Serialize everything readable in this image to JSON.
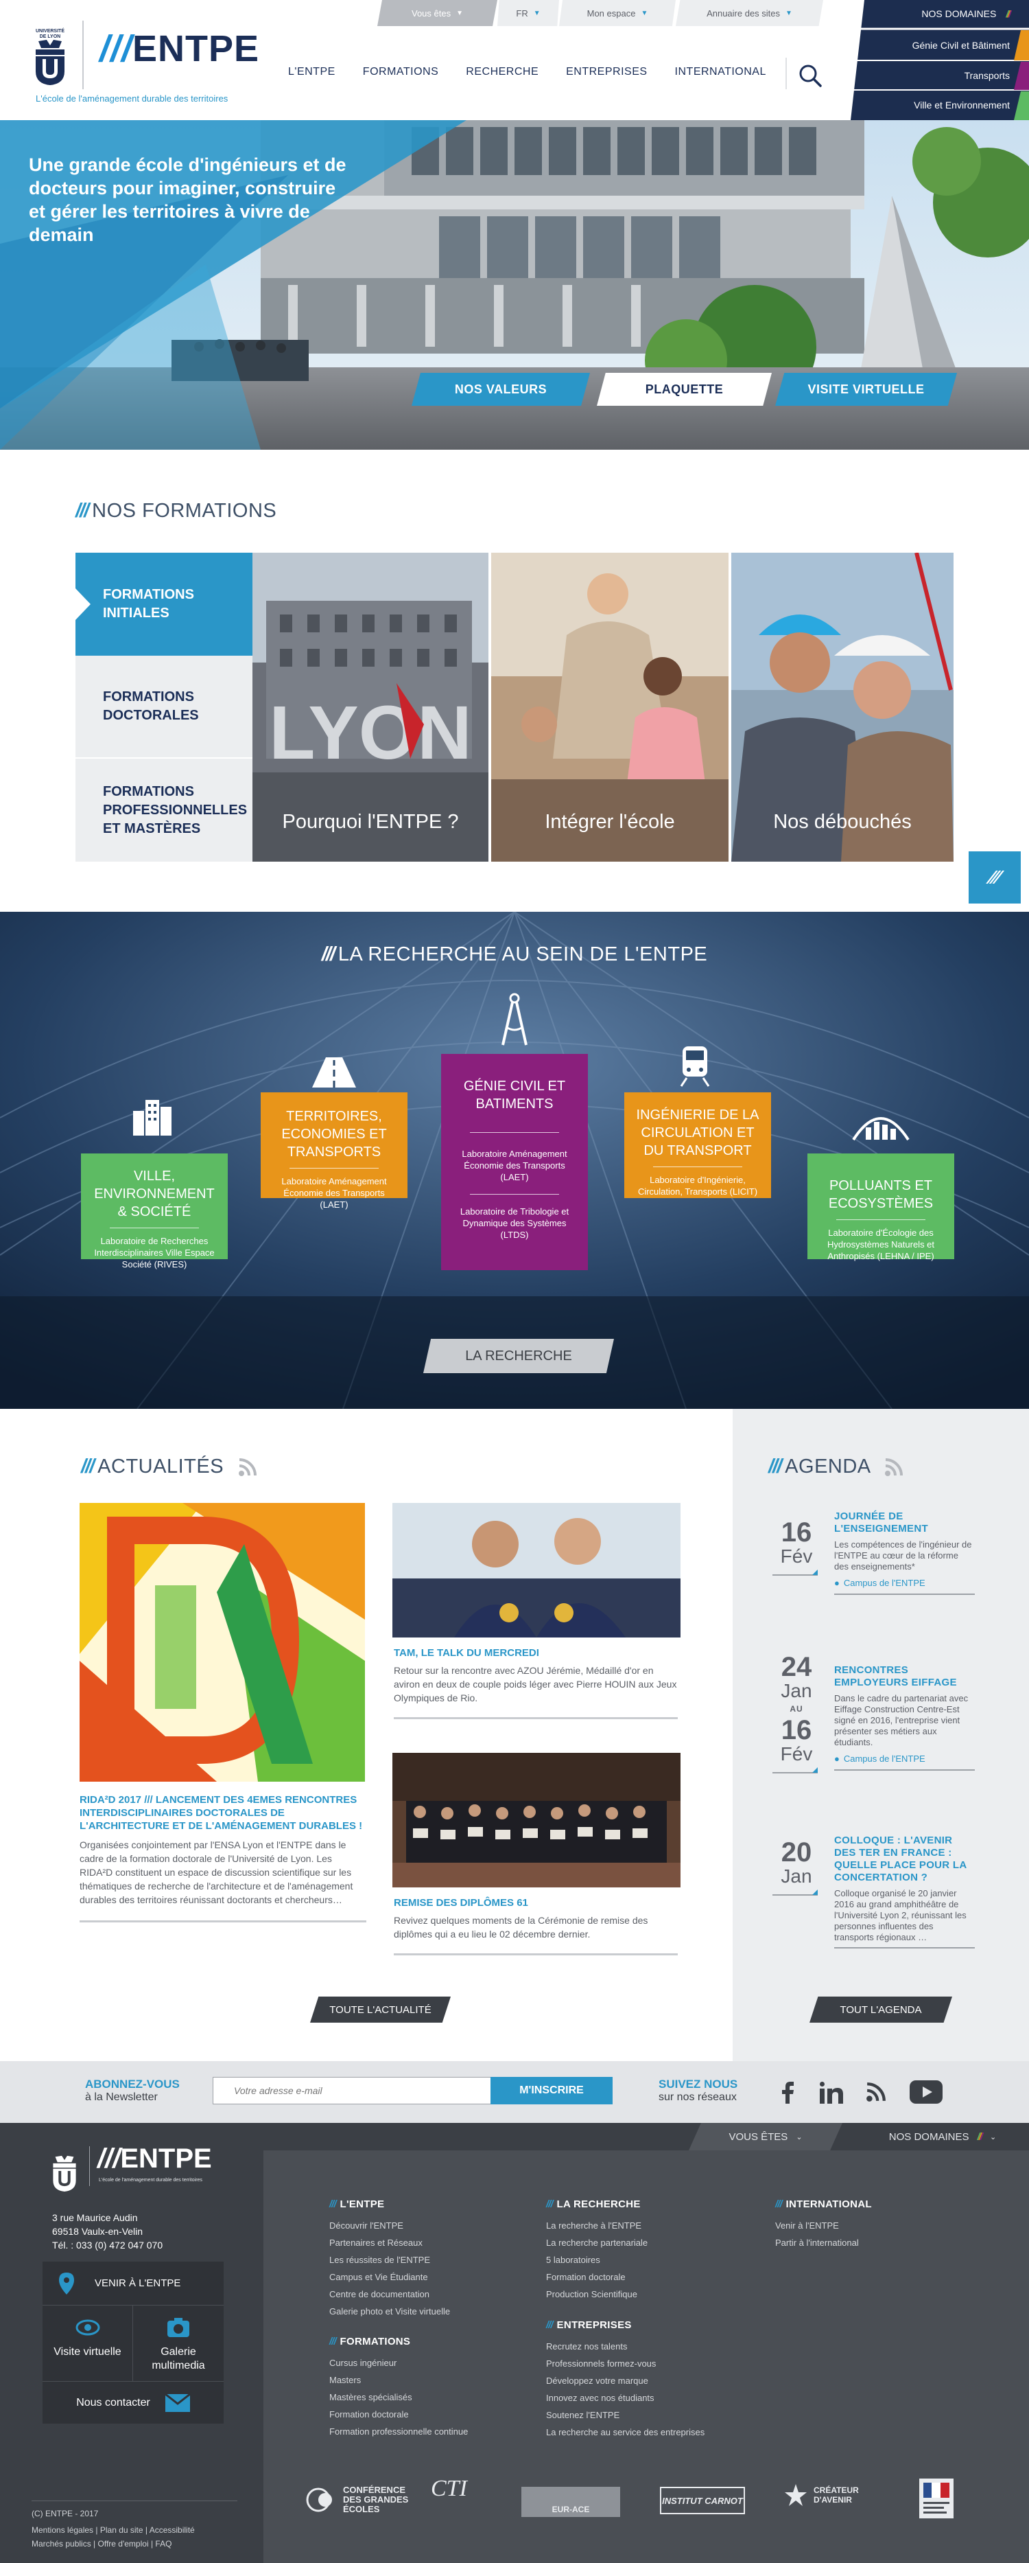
{
  "header": {
    "logo_text": "ENTPE",
    "university_label": "UNIVERSITÉ DE LYON",
    "tagline": "L'école de l'aménagement durable des territoires",
    "utility": {
      "profile": "Vous êtes",
      "lang": "FR",
      "my_space": "Mon espace",
      "sites": "Annuaire des sites"
    },
    "domains": {
      "title": "NOS DOMAINES",
      "items": [
        "Génie Civil et Bâtiment",
        "Transports",
        "Ville et Environnement"
      ]
    },
    "nav": [
      "L'ENTPE",
      "FORMATIONS",
      "RECHERCHE",
      "ENTREPRISES",
      "INTERNATIONAL"
    ]
  },
  "hero": {
    "title": "Une grande école d'ingénieurs et de docteurs pour imaginer, construire et gérer les territoires à vivre de demain",
    "buttons": [
      "NOS VALEURS",
      "PLAQUETTE",
      "VISITE VIRTUELLE"
    ]
  },
  "formations": {
    "title": "NOS FORMATIONS",
    "tabs": [
      "FORMATIONS INITIALES",
      "FORMATIONS DOCTORALES",
      "FORMATIONS PROFESSIONNELLES ET MASTÈRES"
    ],
    "cards": [
      "Pourquoi l'ENTPE ?",
      "Intégrer l'école",
      "Nos débouchés"
    ],
    "photo_sign": "LYON"
  },
  "research": {
    "title": "LA RECHERCHE AU SEIN DE L'ENTPE",
    "cards": [
      {
        "title": "VILLE, ENVIRONNEMENT & SOCIÉTÉ",
        "labs": [
          "Laboratoire de Recherches Interdisciplinaires Ville Espace Société (RIVES)"
        ],
        "color": "#5dbb63"
      },
      {
        "title": "TERRITOIRES, ECONOMIES ET TRANSPORTS",
        "labs": [
          "Laboratoire Aménagement Économie des Transports (LAET)"
        ],
        "color": "#e8951a"
      },
      {
        "title": "GÉNIE CIVIL ET BATIMENTS",
        "labs": [
          "Laboratoire Aménagement Économie des Transports (LAET)",
          "Laboratoire de Tribologie et Dynamique des Systèmes (LTDS)"
        ],
        "color": "#8a1f7c"
      },
      {
        "title": "INGÉNIERIE DE LA CIRCULATION ET DU TRANSPORT",
        "labs": [
          "Laboratoire d'Ingénierie, Circulation, Transports (LICIT)"
        ],
        "color": "#e8951a"
      },
      {
        "title": "POLLUANTS ET ECOSYSTÈMES",
        "labs": [
          "Laboratoire d'Écologie des Hydrosystèmes Naturels et Anthropisés (LEHNA / IPE)"
        ],
        "color": "#5dbb63"
      }
    ],
    "button": "LA RECHERCHE"
  },
  "news": {
    "title": "ACTUALITÉS",
    "items": [
      {
        "title": "RIDA²D 2017 /// LANCEMENT DES 4EMES RENCONTRES INTERDISCIPLINAIRES DOCTORALES DE L'ARCHITECTURE ET DE L'AMÉNAGEMENT DURABLES !",
        "text": "Organisées conjointement par l'ENSA Lyon et l'ENTPE dans le cadre de la formation doctorale de l'Université de Lyon. Les RIDA²D constituent un espace de discussion scientifique sur les thématiques de recherche de l'architecture et de l'aménagement durables des territoires réunissant doctorants et chercheurs…"
      },
      {
        "title": "TAM, LE TALK DU MERCREDI",
        "text": "Retour sur la rencontre avec AZOU Jérémie, Médaillé d'or en aviron en deux de couple poids léger avec Pierre HOUIN aux Jeux Olympiques de Rio."
      },
      {
        "title": "REMISE DES DIPLÔMES 61",
        "text": "Revivez quelques moments de la Cérémonie de remise des diplômes qui a eu lieu le 02 décembre dernier."
      }
    ],
    "button": "TOUTE L'ACTUALITÉ"
  },
  "agenda": {
    "title": "AGENDA",
    "events": [
      {
        "day": "16",
        "month": "Fév",
        "title": "JOURNÉE DE L'ENSEIGNEMENT",
        "text": "Les compétences de l'ingénieur de l'ENTPE au cœur de la réforme des enseignements*",
        "location": "Campus de l'ENTPE"
      },
      {
        "day": "24",
        "month": "Jan",
        "au": "AU",
        "day2": "16",
        "month2": "Fév",
        "title": "RENCONTRES EMPLOYEURS EIFFAGE",
        "text": "Dans le cadre du partenariat avec Eiffage Construction Centre-Est signé en 2016, l'entreprise vient présenter ses métiers aux étudiants.",
        "location": "Campus de l'ENTPE"
      },
      {
        "day": "20",
        "month": "Jan",
        "title": "COLLOQUE : L'AVENIR DES TER EN FRANCE : QUELLE PLACE POUR LA CONCERTATION ?",
        "text": "Colloque organisé le 20 janvier 2016 au grand amphithéâtre de l'Université Lyon 2, réunissant les personnes influentes des transports régionaux …"
      }
    ],
    "button": "TOUT L'AGENDA"
  },
  "newsletter": {
    "subscribe_title": "ABONNEZ-VOUS",
    "subscribe_sub": "à la Newsletter",
    "email_placeholder": "Votre adresse e-mail",
    "submit": "M'INSCRIRE",
    "follow_title": "SUIVEZ NOUS",
    "follow_sub": "sur nos réseaux"
  },
  "footer": {
    "top_links": {
      "profile": "VOUS ÊTES",
      "domains": "NOS DOMAINES"
    },
    "logo_text": "ENTPE",
    "tagline": "L'école de l'aménagement durable des territoires",
    "address": [
      "3 rue Maurice Audin",
      "69518 Vaulx-en-Velin",
      "Tél. : 033 (0) 472 047 070"
    ],
    "come": "VENIR À L'ENTPE",
    "visit": "Visite virtuelle",
    "gallery": "Galerie multimedia",
    "contact": "Nous contacter",
    "copyright": "(C) ENTPE - 2017",
    "legal": [
      "Mentions légales",
      "Plan du site",
      "Accessibilité",
      "Marchés publics",
      "Offre d'emploi",
      "FAQ"
    ],
    "columns": [
      {
        "title": "L'ENTPE",
        "items": [
          "Découvrir l'ENTPE",
          "Partenaires et Réseaux",
          "Les réussites de l'ENTPE",
          "Campus et Vie Étudiante",
          "Centre de documentation",
          "Galerie photo et Visite virtuelle"
        ]
      },
      {
        "title": "FORMATIONS",
        "items": [
          "Cursus ingénieur",
          "Masters",
          "Mastères spécialisés",
          "Formation doctorale",
          "Formation professionnelle continue"
        ]
      },
      {
        "title": "LA RECHERCHE",
        "items": [
          "La recherche à l'ENTPE",
          "La recherche partenariale",
          "5 laboratoires",
          "Formation doctorale",
          "Production Scientifique"
        ]
      },
      {
        "title": "ENTREPRISES",
        "items": [
          "Recrutez nos talents",
          "Professionnels formez-vous",
          "Développez votre marque",
          "Innovez avec nos étudiants",
          "Soutenez l'ENTPE",
          "La recherche au service des entreprises"
        ]
      },
      {
        "title": "INTERNATIONAL",
        "items": [
          "Venir à l'ENTPE",
          "Partir à l'international"
        ]
      }
    ],
    "partners": [
      "CONFÉRENCE DES GRANDES ÉCOLES",
      "CTI",
      "EUR-ACE",
      "INSTITUT CARNOT",
      "CRÉATEUR D'AVENIR"
    ]
  },
  "colors": {
    "blue": "#2a96c8",
    "navy": "#1b2e57",
    "green": "#5dbb63",
    "orange": "#e8951a",
    "purple": "#8a1f7c"
  }
}
